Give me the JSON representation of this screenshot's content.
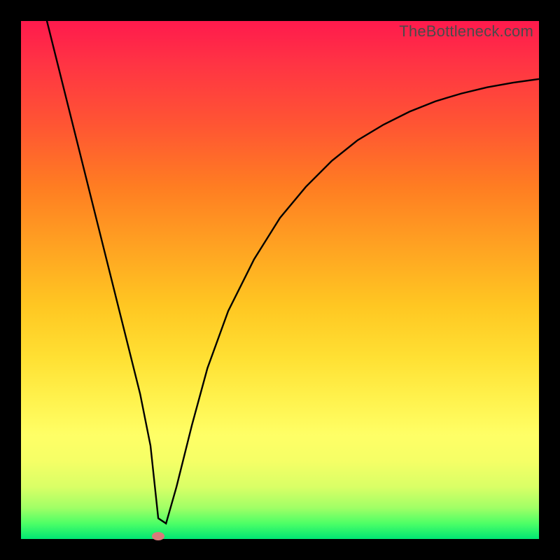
{
  "watermark": "TheBottleneck.com",
  "chart_data": {
    "type": "line",
    "title": "",
    "xlabel": "",
    "ylabel": "",
    "xlim": [
      0,
      100
    ],
    "ylim": [
      0,
      100
    ],
    "background_gradient": {
      "top": "#ff1a4d",
      "bottom": "#00e673",
      "meaning": "red-high-to-green-low bottleneck severity"
    },
    "series": [
      {
        "name": "bottleneck-curve",
        "x": [
          5,
          7,
          9,
          11,
          13,
          15,
          17,
          19,
          21,
          23,
          25,
          26.5,
          28,
          30,
          33,
          36,
          40,
          45,
          50,
          55,
          60,
          65,
          70,
          75,
          80,
          85,
          90,
          95,
          100
        ],
        "y": [
          100,
          92,
          84,
          76,
          68,
          60,
          52,
          44,
          36,
          28,
          18,
          4,
          3,
          10,
          22,
          33,
          44,
          54,
          62,
          68,
          73,
          77,
          80,
          82.5,
          84.5,
          86,
          87.2,
          88.1,
          88.8
        ]
      }
    ],
    "annotations": [
      {
        "name": "minimum-marker",
        "x": 26.5,
        "y": 0.5,
        "color": "#d97a7a",
        "shape": "ellipse"
      }
    ]
  }
}
